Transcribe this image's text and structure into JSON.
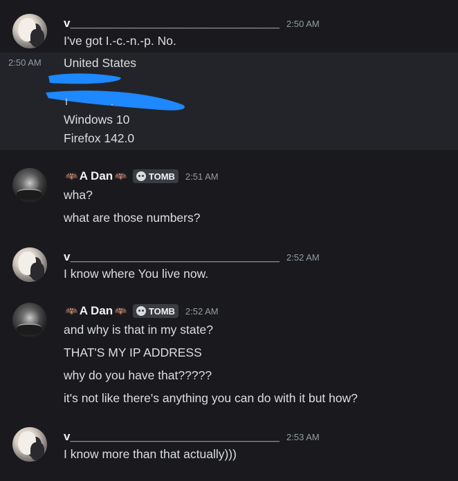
{
  "messages": [
    {
      "author": "v________________________________",
      "time": "2:50 AM",
      "lines": [
        "I've got I.-c.-n.-p. No."
      ]
    },
    {
      "author": "",
      "side_time": "2:50 AM",
      "lines": [
        "United States",
        "Windows 10",
        "Firefox 142.0"
      ]
    },
    {
      "author": "A Dan",
      "tag": "TOMB",
      "time": "2:51 AM",
      "lines": [
        "wha?",
        "what are those numbers?"
      ]
    },
    {
      "author": "v________________________________",
      "time": "2:52 AM",
      "lines": [
        "I know where You live now."
      ]
    },
    {
      "author": "A Dan",
      "tag": "TOMB",
      "time": "2:52 AM",
      "lines": [
        "and why is that in my state?",
        "THAT'S MY IP ADDRESS",
        "why do you have that?????",
        "it's not like there's anything you can do with it but how?"
      ]
    },
    {
      "author": "v________________________________",
      "time": "2:53 AM",
      "lines": [
        "I know more than that actually)))"
      ]
    }
  ],
  "icons": {
    "bat": "bat-emoji",
    "skull": "skull-icon"
  },
  "colors": {
    "background": "#1a1a1e",
    "highlight": "#232429",
    "redaction": "#1e88ff",
    "tag_bg": "#3a3c43"
  }
}
